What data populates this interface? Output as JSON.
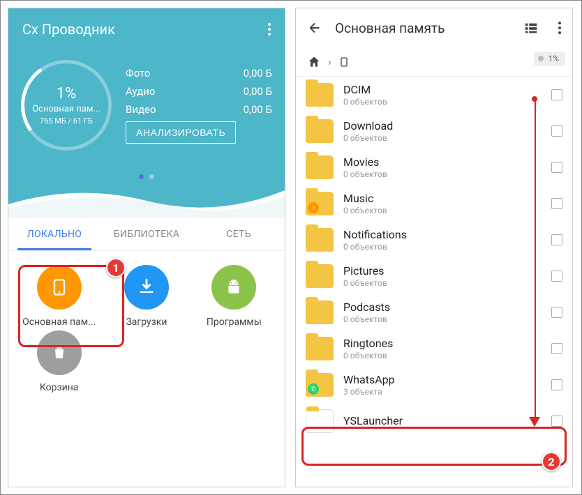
{
  "left": {
    "app_title": "Cx Проводник",
    "gauge": {
      "percent": "1%",
      "label": "Основная пам...",
      "size": "765 МБ / 61 ГБ"
    },
    "stats": [
      {
        "name": "Фото",
        "value": "0,00 Б"
      },
      {
        "name": "Аудио",
        "value": "0,00 Б"
      },
      {
        "name": "Видео",
        "value": "0,00 Б"
      }
    ],
    "analyze_btn": "АНАЛИЗИРОВАТЬ",
    "tabs": {
      "local": "ЛОКАЛЬНО",
      "library": "БИБЛИОТЕКА",
      "network": "СЕТЬ"
    },
    "items": {
      "storage": "Основная пам...",
      "downloads": "Загрузки",
      "programs": "Программы",
      "trash": "Корзина"
    }
  },
  "right": {
    "title": "Основная память",
    "usage_pill": "1%",
    "folders": [
      {
        "name": "DCIM",
        "sub": "0 объектов"
      },
      {
        "name": "Download",
        "sub": "0 объектов"
      },
      {
        "name": "Movies",
        "sub": "0 объектов"
      },
      {
        "name": "Music",
        "sub": "0 объектов"
      },
      {
        "name": "Notifications",
        "sub": "0 объектов"
      },
      {
        "name": "Pictures",
        "sub": "0 объектов"
      },
      {
        "name": "Podcasts",
        "sub": "0 объектов"
      },
      {
        "name": "Ringtones",
        "sub": "0 объектов"
      },
      {
        "name": "WhatsApp",
        "sub": "3 объекта"
      },
      {
        "name": "YSLauncher",
        "sub": ""
      }
    ]
  },
  "callouts": {
    "one": "1",
    "two": "2"
  }
}
